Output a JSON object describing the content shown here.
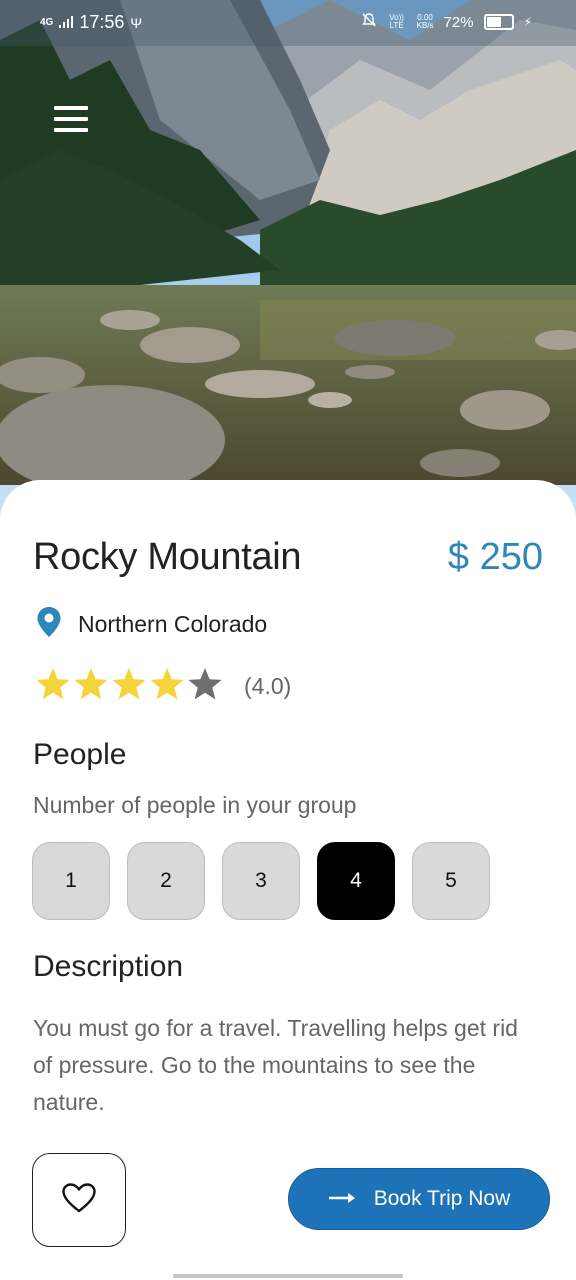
{
  "status_bar": {
    "network": "4G",
    "time": "17:56",
    "volte": "Vo)) LTE",
    "speed_value": "0.00",
    "speed_unit": "KB/s",
    "battery": "72%",
    "battery_level": 0.72
  },
  "destination": {
    "title": "Rocky Mountain",
    "price": "$ 250",
    "location": "Northern Colorado",
    "rating": 4.0,
    "rating_max": 5,
    "rating_label": "(4.0)"
  },
  "people": {
    "heading": "People",
    "subtitle": "Number of people in your group",
    "options": [
      "1",
      "2",
      "3",
      "4",
      "5"
    ],
    "selected": "4"
  },
  "description": {
    "heading": "Description",
    "text": "You must go for a travel. Travelling helps get rid of pressure. Go to the mountains to see the nature."
  },
  "actions": {
    "book_label": "Book Trip Now"
  },
  "colors": {
    "accent": "#2f86b8",
    "button": "#1e73b8",
    "star_filled": "#f5d33a",
    "star_empty": "#6e6e6e"
  },
  "icons": {
    "menu": "hamburger-icon",
    "location": "map-pin-icon",
    "favorite": "heart-outline-icon",
    "book": "arrow-right-icon"
  }
}
